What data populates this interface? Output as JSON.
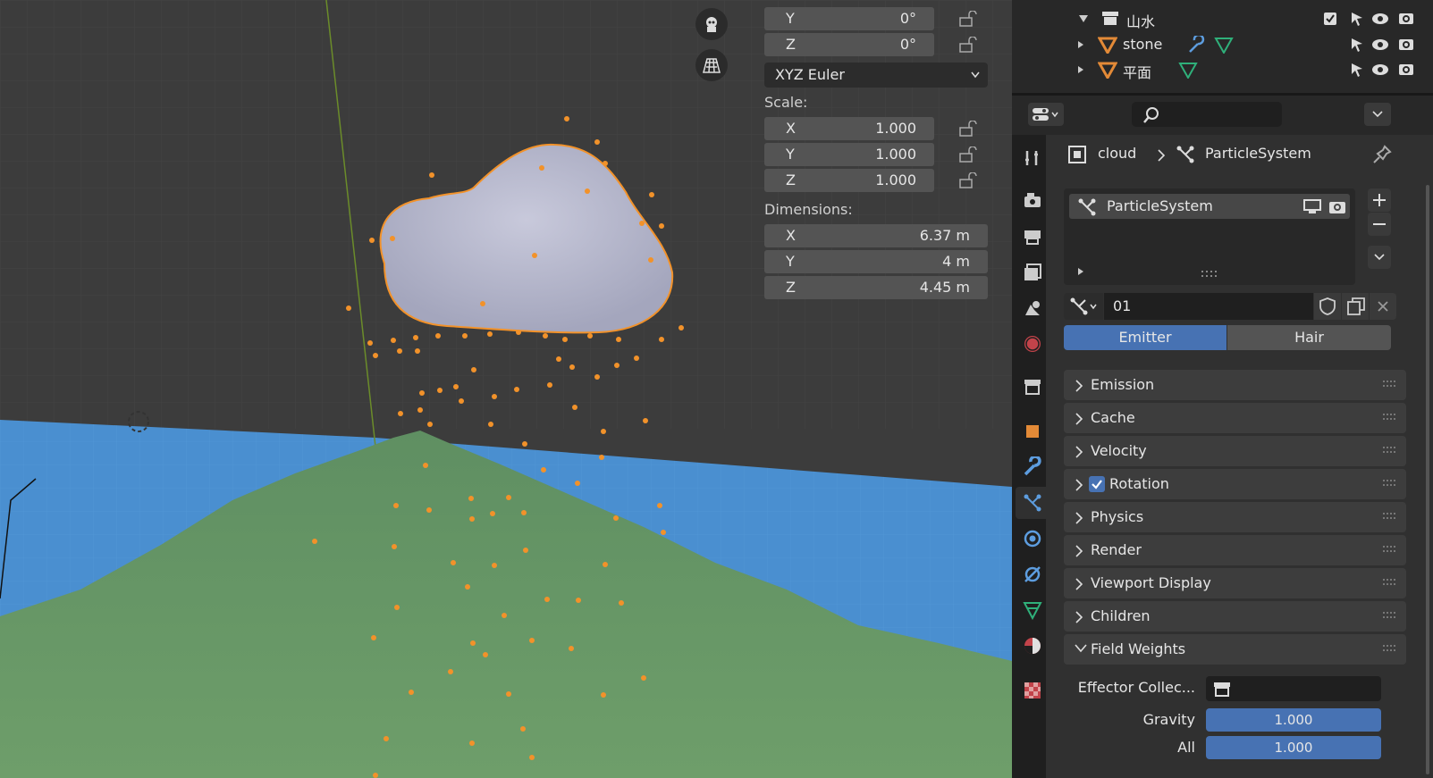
{
  "transform": {
    "rotation": {
      "y": "0°",
      "z": "0°",
      "axis_y": "Y",
      "axis_z": "Z"
    },
    "rotation_mode": "XYZ Euler",
    "scale_label": "Scale:",
    "scale": {
      "x": "1.000",
      "y": "1.000",
      "z": "1.000"
    },
    "dimensions_label": "Dimensions:",
    "dimensions": {
      "x": "6.37 m",
      "y": "4 m",
      "z": "4.45 m"
    },
    "axes": {
      "x": "X",
      "y": "Y",
      "z": "Z"
    }
  },
  "outliner": {
    "collection": "山水",
    "items": [
      {
        "name": "stone"
      },
      {
        "name": "平面"
      }
    ]
  },
  "properties": {
    "search_placeholder": "",
    "breadcrumb": {
      "object": "cloud",
      "system": "ParticleSystem"
    },
    "particle_list": [
      "ParticleSystem"
    ],
    "settings_name": "01",
    "type_tabs": {
      "emitter": "Emitter",
      "hair": "Hair",
      "active": "Emitter"
    },
    "panels": [
      "Emission",
      "Cache",
      "Velocity",
      "Rotation",
      "Physics",
      "Render",
      "Viewport Display",
      "Children",
      "Field Weights"
    ],
    "field_weights": {
      "effector_label": "Effector Collec...",
      "gravity_label": "Gravity",
      "gravity_value": "1.000",
      "all_label": "All",
      "all_value": "1.000"
    }
  },
  "colors": {
    "accent": "#4772b3",
    "selection": "#f2922a",
    "terrain": "#6a9a6a",
    "water": "#4a8fd0"
  }
}
